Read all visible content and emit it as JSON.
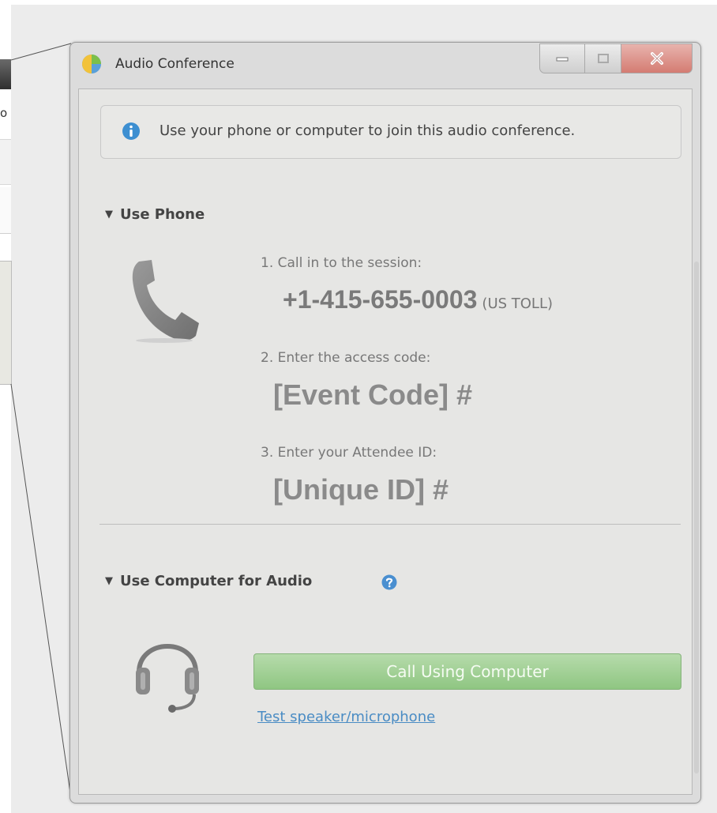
{
  "background": {
    "partial_text": "o"
  },
  "window": {
    "title": "Audio Conference",
    "buttons": {
      "minimize": "minimize",
      "maximize": "maximize",
      "close": "close"
    }
  },
  "info": {
    "text": "Use your phone or computer to join this audio conference.",
    "icon": "info-icon"
  },
  "phone_section": {
    "header": "Use Phone",
    "icon": "phone-icon",
    "step1_label": "1. Call in to the session:",
    "phone_number": "+1-415-655-0003",
    "phone_note": "(US TOLL)",
    "step2_label": "2. Enter the access code:",
    "access_code": "[Event Code] #",
    "step3_label": "3. Enter your Attendee ID:",
    "attendee_id": "[Unique ID] #"
  },
  "computer_section": {
    "header": "Use Computer for Audio",
    "help_icon": "help-icon",
    "icon": "headset-icon",
    "call_button": "Call Using Computer",
    "test_link": "Test speaker/microphone"
  },
  "colors": {
    "call_button": "#9ccf8f",
    "link": "#4a8cc4",
    "info_icon": "#3d8fd1",
    "close_button": "#d47c72"
  }
}
